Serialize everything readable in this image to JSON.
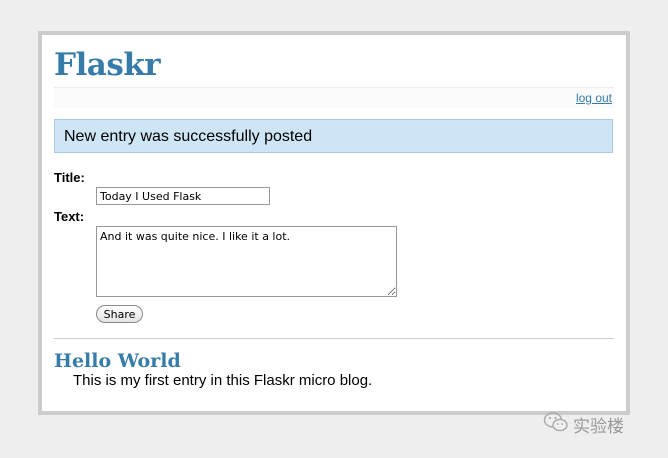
{
  "header": {
    "title": "Flaskr"
  },
  "metanav": {
    "logout": "log out"
  },
  "flash": {
    "message": "New entry was successfully posted"
  },
  "form": {
    "title_label": "Title:",
    "title_value": "Today I Used Flask",
    "text_label": "Text:",
    "text_value": "And it was quite nice. I like it a lot.",
    "share_label": "Share"
  },
  "entries": [
    {
      "title": "Hello World",
      "text": "This is my first entry in this Flaskr micro blog."
    }
  ],
  "watermark": {
    "icon": "wechat-icon",
    "text": "实验楼"
  },
  "colors": {
    "accent": "#377ba8",
    "flash_bg": "#cee5f5",
    "page_bg": "#eeeeee"
  }
}
